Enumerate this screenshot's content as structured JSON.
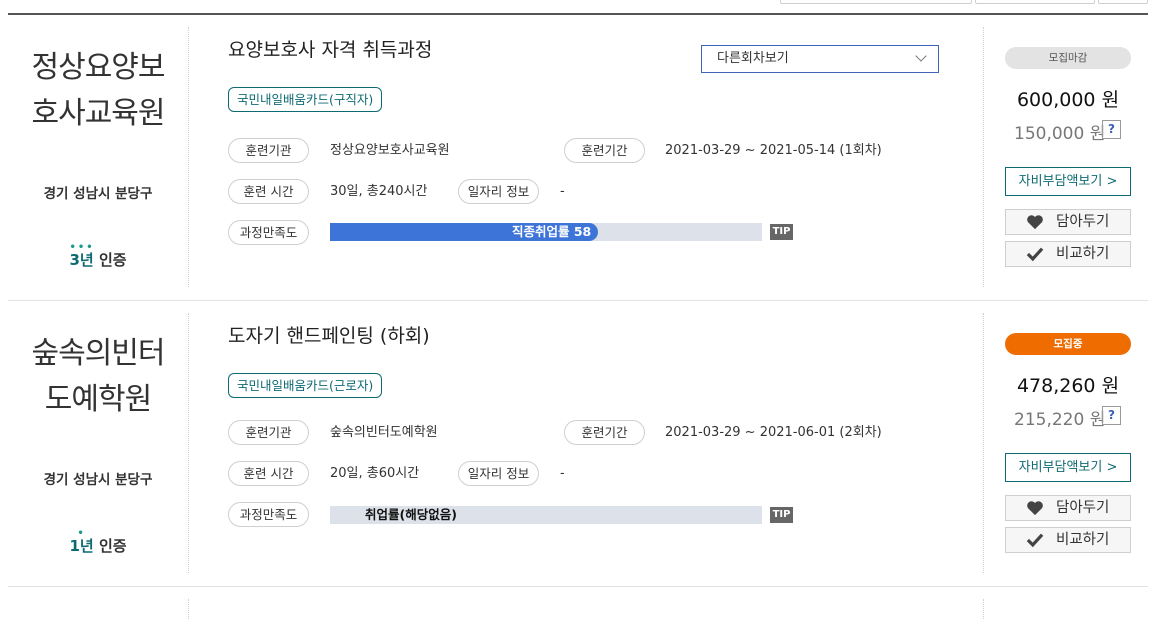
{
  "courses": [
    {
      "institution_name": "정상요양보호사교육원",
      "institution_name_line1": "정상요양보",
      "institution_name_line2": "호사교육원",
      "region": "경기 성남시 분당구",
      "cert_years": "3년",
      "cert_label": "인증",
      "title": "요양보호사 자격 취득과정",
      "dropdown_label": "다른회차보기",
      "card_tag": "국민내일배움카드(구직자)",
      "training_org_label": "훈련기관",
      "training_org_value": "정상요양보호사교육원",
      "training_period_label": "훈련기간",
      "training_period_value": "2021-03-29 ~ 2021-05-14 (1회차)",
      "training_time_label": "훈련 시간",
      "training_time_value": "30일, 총240시간",
      "job_info_label": "일자리 정보",
      "job_info_value": "-",
      "satisfaction_label": "과정만족도",
      "bar_text": "직종취업률 58",
      "bar_fraction": 0.62,
      "tip_label": "TIP",
      "status": "모집마감",
      "status_type": "closed",
      "price": "600,000 원",
      "self_price": "150,000 원",
      "qmark": "?",
      "cost_button": "자비부담액보기 >",
      "save_button": "담아두기",
      "compare_button": "비교하기"
    },
    {
      "institution_name": "숲속의빈터도예학원",
      "institution_name_line1": "숲속의빈터",
      "institution_name_line2": "도예학원",
      "region": "경기 성남시 분당구",
      "cert_years": "1년",
      "cert_label": "인증",
      "title": "도자기 핸드페인팅 (하회)",
      "card_tag": "국민내일배움카드(근로자)",
      "training_org_label": "훈련기관",
      "training_org_value": "숲속의빈터도예학원",
      "training_period_label": "훈련기간",
      "training_period_value": "2021-03-29 ~ 2021-06-01 (2회차)",
      "training_time_label": "훈련 시간",
      "training_time_value": "20일, 총60시간",
      "job_info_label": "일자리 정보",
      "job_info_value": "-",
      "satisfaction_label": "과정만족도",
      "bar_text": "취업률(해당없음)",
      "bar_fraction": 0,
      "tip_label": "TIP",
      "status": "모집중",
      "status_type": "open",
      "price": "478,260 원",
      "self_price": "215,220 원",
      "qmark": "?",
      "cost_button": "자비부담액보기 >",
      "save_button": "담아두기",
      "compare_button": "비교하기"
    }
  ],
  "colors": {
    "accent_teal": "#0f6b73",
    "bar_fill": "#3d74d8",
    "bar_track": "#dde2ea",
    "status_open": "#ee6c00",
    "status_closed": "#e3e3e3",
    "dropdown_border": "#3f64b8"
  },
  "icons": {
    "save": "heart-icon",
    "compare": "check-icon",
    "dropdown": "chevron-down-icon"
  }
}
